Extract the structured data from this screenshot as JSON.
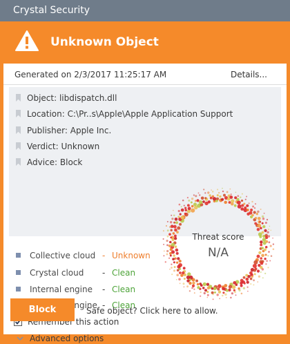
{
  "window": {
    "title": "Crystal Security"
  },
  "header": {
    "title": "Unknown Object",
    "icon": "warning-icon"
  },
  "report": {
    "generated": "Generated on 2/3/2017 11:25:17 AM",
    "details_label": "Details..."
  },
  "info": {
    "object": "Object: libdispatch.dll",
    "location": "Location: C:\\Pr..s\\Apple\\Apple Application Support",
    "publisher": "Publisher: Apple Inc.",
    "verdict": "Verdict: Unknown",
    "advice": "Advice: Block"
  },
  "engines": [
    {
      "name": "Collective cloud",
      "dash": "-",
      "status": "Unknown"
    },
    {
      "name": "Crystal cloud",
      "dash": "-",
      "status": "Clean"
    },
    {
      "name": "Internal engine",
      "dash": "-",
      "status": "Clean"
    },
    {
      "name": "Heuristic engine",
      "dash": "-",
      "status": "Clean"
    }
  ],
  "threat": {
    "label": "Threat score",
    "value": "N/A"
  },
  "options": {
    "remember_label": "Remember this action",
    "remember_checked": true,
    "advanced_label": "Advanced options"
  },
  "actions": {
    "block_label": "Block",
    "allow_label": "Safe object? Click here to allow."
  },
  "colors": {
    "accent": "#f58a2a",
    "titlebar": "#6f7c8a",
    "unknown": "#ee7d2b",
    "clean": "#4ea43a"
  }
}
